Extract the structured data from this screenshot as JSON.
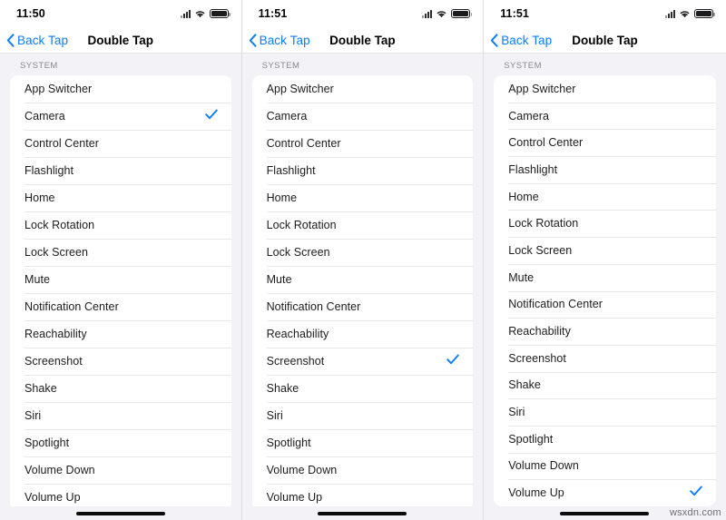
{
  "watermark": "wsxdn.com",
  "common": {
    "nav_back_label": "Back Tap",
    "nav_title": "Double Tap",
    "section_header": "SYSTEM",
    "accent_color": "#0a7cff",
    "background_color": "#f2f2f7",
    "card_color": "#ffffff",
    "text_color": "#1c1c1e",
    "section_header_color": "#8a8a8e",
    "icons": {
      "back_chevron": "chevron-left-icon",
      "cellular": "cellular-signal-icon",
      "wifi": "wifi-icon",
      "battery": "battery-icon",
      "checkmark": "checkmark-icon"
    },
    "items": [
      "App Switcher",
      "Camera",
      "Control Center",
      "Flashlight",
      "Home",
      "Lock Rotation",
      "Lock Screen",
      "Mute",
      "Notification Center",
      "Reachability",
      "Screenshot",
      "Shake",
      "Siri",
      "Spotlight",
      "Volume Down",
      "Volume Up"
    ]
  },
  "panels": [
    {
      "id": "panel-1",
      "status_time": "11:50",
      "selected_item": "Camera"
    },
    {
      "id": "panel-2",
      "status_time": "11:51",
      "selected_item": "Screenshot"
    },
    {
      "id": "panel-3",
      "status_time": "11:51",
      "selected_item": "Volume Up"
    }
  ]
}
